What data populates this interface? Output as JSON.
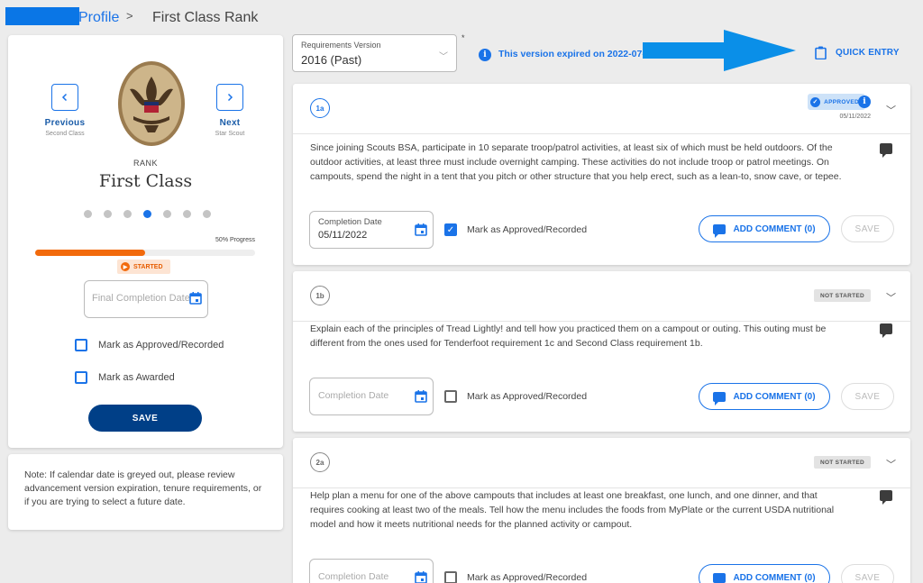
{
  "breadcrumb": {
    "link": "Profile",
    "separator": ">",
    "current": "First Class Rank"
  },
  "rank_panel": {
    "previous_label": "Previous",
    "previous_sub": "Second Class",
    "next_label": "Next",
    "next_sub": "Star Scout",
    "rank_caption": "RANK",
    "rank_name": "First Class",
    "progress_label": "50% Progress",
    "progress_fraction": 0.5,
    "status": "STARTED",
    "final_date_placeholder": "Final Completion Date",
    "approved_label": "Mark as Approved/Recorded",
    "awarded_label": "Mark as Awarded",
    "save_label": "SAVE"
  },
  "note": "Note: If calendar date is greyed out, please review advancement version expiration, tenure requirements, or if you are trying to select a future date.",
  "version": {
    "caption": "Requirements Version",
    "value": "2016 (Past)",
    "required_mark": "*"
  },
  "expired_text": "This version expired on 2022-07-3",
  "quick_entry": "QUICK ENTRY",
  "colors": {
    "accent": "#1a73e8",
    "primary_dark": "#003f87",
    "progress": "#f26a0c",
    "arrow": "#0a8fe8"
  },
  "requirements": [
    {
      "id": "1a",
      "status": "APPROVED",
      "date_shown": "05/11/2022",
      "text": "Since joining Scouts BSA, participate in 10 separate troop/patrol activities, at least six of which must be held outdoors. Of the outdoor activities, at least three must include overnight camping. These activities do not include troop or patrol meetings. On campouts, spend the night in a tent that you pitch or other structure that you help erect, such as a lean-to, snow cave, or tepee.",
      "completion_caption": "Completion Date",
      "completion_value": "05/11/2022",
      "approved_label": "Mark as Approved/Recorded",
      "comment_label": "ADD COMMENT (0)",
      "save_label": "SAVE"
    },
    {
      "id": "1b",
      "status": "NOT STARTED",
      "text": "Explain each of the principles of Tread Lightly! and tell how you practiced them on a campout or outing. This outing must be different from the ones used for Tenderfoot requirement 1c and Second Class requirement 1b.",
      "completion_placeholder": "Completion Date",
      "approved_label": "Mark as Approved/Recorded",
      "comment_label": "ADD COMMENT (0)",
      "save_label": "SAVE"
    },
    {
      "id": "2a",
      "status": "NOT STARTED",
      "text": "Help plan a menu for one of the above campouts that includes at least one breakfast, one lunch, and one dinner, and that requires cooking at least two of the meals. Tell how the menu includes the foods from MyPlate or the current USDA nutritional model and how it meets nutritional needs for the planned activity or campout.",
      "completion_placeholder": "Completion Date",
      "approved_label": "Mark as Approved/Recorded",
      "comment_label": "ADD COMMENT (0)",
      "save_label": "SAVE"
    }
  ]
}
